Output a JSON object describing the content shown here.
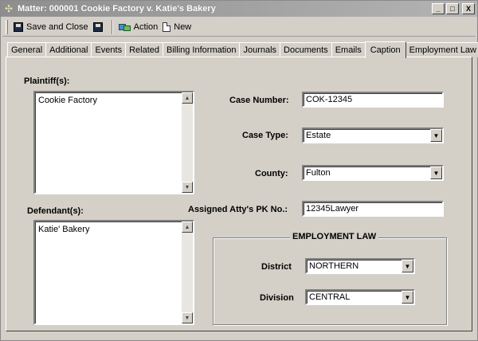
{
  "window": {
    "title": "Matter: 000001 Cookie Factory v. Katie's Bakery",
    "controls": {
      "minimize": "_",
      "maximize": "□",
      "close": "X"
    }
  },
  "toolbar": {
    "save_close_label": "Save and Close",
    "action_label": "Action",
    "new_label": "New",
    "icons": [
      "floppy-disk-icon",
      "floppy-disk-icon",
      "action-icon",
      "new-document-icon"
    ]
  },
  "tabs": [
    {
      "label": "General"
    },
    {
      "label": "Additional"
    },
    {
      "label": "Events"
    },
    {
      "label": "Related"
    },
    {
      "label": "Billing Information"
    },
    {
      "label": "Journals"
    },
    {
      "label": "Documents"
    },
    {
      "label": "Emails"
    },
    {
      "label": "Caption",
      "active": true
    },
    {
      "label": "Employment Law"
    }
  ],
  "caption": {
    "plaintiffs_label": "Plaintiff(s):",
    "plaintiffs": [
      "Cookie Factory"
    ],
    "defendants_label": "Defendant(s):",
    "defendants": [
      "Katie' Bakery"
    ],
    "case_number_label": "Case Number:",
    "case_number": "COK-12345",
    "case_type_label": "Case Type:",
    "case_type": "Estate",
    "county_label": "County:",
    "county": "Fulton",
    "atty_pk_label": "Assigned Atty's PK No.:",
    "atty_pk": "12345Lawyer"
  },
  "employment_law": {
    "title": "EMPLOYMENT LAW",
    "district_label": "District",
    "district": "NORTHERN",
    "division_label": "Division",
    "division": "CENTRAL"
  },
  "scroll_glyphs": {
    "up": "▲",
    "down": "▼"
  }
}
